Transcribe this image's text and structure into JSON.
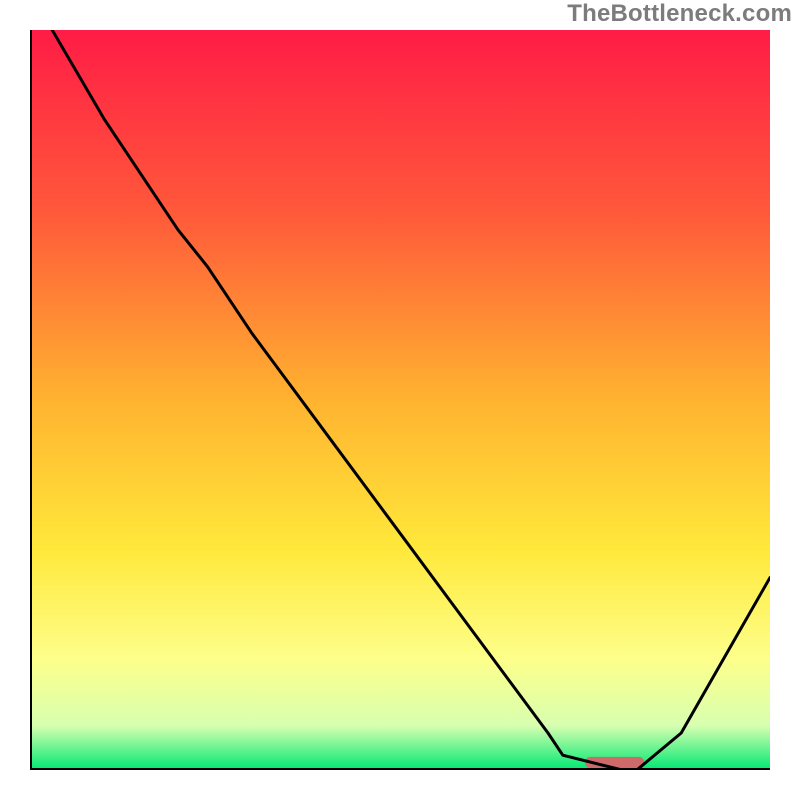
{
  "credit": "TheBottleneck.com",
  "chart_data": {
    "type": "line",
    "title": "",
    "xlabel": "",
    "ylabel": "",
    "xlim": [
      0,
      100
    ],
    "ylim": [
      0,
      100
    ],
    "series": [
      {
        "name": "bottleneck-curve",
        "x": [
          3,
          10,
          20,
          24,
          30,
          40,
          50,
          60,
          70,
          72,
          80,
          82,
          88,
          100
        ],
        "y": [
          100,
          88,
          73,
          68,
          59,
          45.5,
          32,
          18.5,
          5,
          2,
          0,
          0,
          5,
          26
        ]
      }
    ],
    "optimal_marker": {
      "x": 79,
      "y": 0,
      "width": 8,
      "height": 1.5,
      "color": "#cf6a6a"
    },
    "gradient_stops": [
      {
        "offset": 0,
        "color": "#ff1c46"
      },
      {
        "offset": 25,
        "color": "#ff5a3a"
      },
      {
        "offset": 50,
        "color": "#ffb330"
      },
      {
        "offset": 70,
        "color": "#ffe83a"
      },
      {
        "offset": 85,
        "color": "#fdff8a"
      },
      {
        "offset": 94,
        "color": "#d8ffb0"
      },
      {
        "offset": 100,
        "color": "#00e873"
      }
    ],
    "axis_color": "#000000",
    "line_color": "#000000"
  }
}
